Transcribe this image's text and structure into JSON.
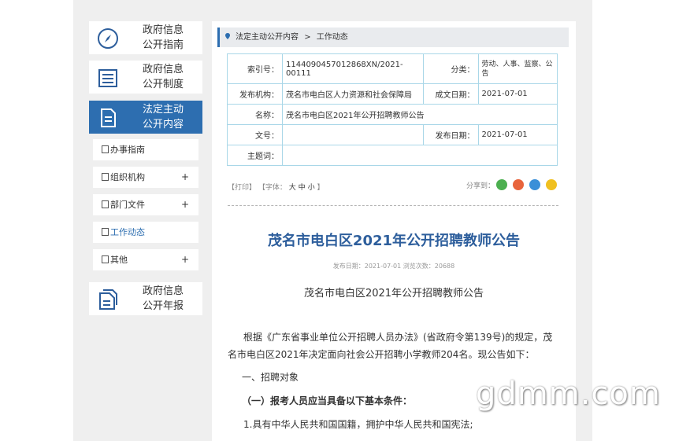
{
  "sidebar": {
    "cards": [
      {
        "label1": "政府信息",
        "label2": "公开指南",
        "icon": "compass-icon"
      },
      {
        "label1": "政府信息",
        "label2": "公开制度",
        "icon": "list-icon"
      },
      {
        "label1": "法定主动",
        "label2": "公开内容",
        "icon": "document-icon"
      },
      {
        "label1": "政府信息",
        "label2": "公开年报",
        "icon": "report-icon"
      }
    ],
    "subs": [
      {
        "label": "办事指南",
        "plus": ""
      },
      {
        "label": "组织机构",
        "plus": "+"
      },
      {
        "label": "部门文件",
        "plus": "+"
      },
      {
        "label": "工作动态",
        "plus": ""
      },
      {
        "label": "其他",
        "plus": "+"
      }
    ]
  },
  "breadcrumb": {
    "item1": "法定主动公开内容",
    "sep": ">",
    "item2": "工作动态"
  },
  "meta": {
    "index_label": "索引号：",
    "index_value": "1144090457012868XN/2021-00111",
    "class_label": "分类：",
    "class_value": "劳动、人事、监察、公告",
    "publisher_label": "发布机构：",
    "publisher_value": "茂名市电白区人力资源和社会保障局",
    "created_label": "成文日期：",
    "created_value": "2021-07-01",
    "name_label": "名称：",
    "name_value": "茂名市电白区2021年公开招聘教师公告",
    "doc_label": "文号：",
    "doc_value": "",
    "pub_label": "发布日期：",
    "pub_value": "2021-07-01",
    "subject_label": "主题词：",
    "subject_value": ""
  },
  "tools": {
    "print": "【打印】",
    "font": "【字体：",
    "big": "大",
    "mid": "中",
    "small": "小",
    "end": "】",
    "share": "分享到："
  },
  "article": {
    "title": "茂名市电白区2021年公开招聘教师公告",
    "meta": "发布日期：2021-07-01   浏览次数：20688",
    "heading": "茂名市电白区2021年公开招聘教师公告",
    "p1a": "根据《广东省事业单位公开招聘人员办法》(省政府令第139号)的规定，茂",
    "p1b": "名市电白区2021年决定面向社会公开招聘小学教师204名。现公告如下：",
    "s1": "一、招聘对象",
    "s2": "（一）报考人员应当具备以下基本条件：",
    "s3": "1.具有中华人民共和国国籍，拥护中华人民共和国宪法;"
  },
  "watermark": "gdmm.com"
}
